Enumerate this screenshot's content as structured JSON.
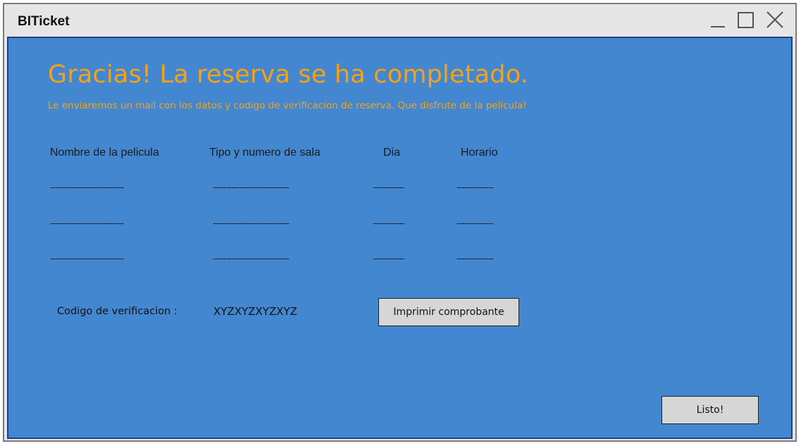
{
  "window": {
    "title": "BITicket"
  },
  "header": {
    "title": "Gracias! La reserva se ha completado.",
    "subtitle": "Le enviaremos un mail con los datos y codigo de verificacion de reserva. Que disfrute de la pelicula!"
  },
  "table": {
    "columns": [
      "Nombre de la pelicula",
      "Tipo y numero de sala",
      "Dia",
      "Horario"
    ],
    "rows": [
      [
        "----------------------------",
        "-----------------------------",
        "------------",
        "--------------"
      ],
      [
        "----------------------------",
        "-----------------------------",
        "------------",
        "--------------"
      ],
      [
        "----------------------------",
        "-----------------------------",
        "------------",
        "--------------"
      ]
    ]
  },
  "verification": {
    "label": "Codigo de verificacion :",
    "code": "XYZXYZXYZXYZ",
    "print_button": "Imprimir comprobante"
  },
  "footer": {
    "done_button": "Listo!"
  },
  "colors": {
    "background": "#4287d0",
    "accent": "#f8a213",
    "titlebar": "#e6e6e6",
    "button": "#d6d6d6"
  },
  "icons": [
    "minimize-icon",
    "maximize-icon",
    "close-icon"
  ]
}
